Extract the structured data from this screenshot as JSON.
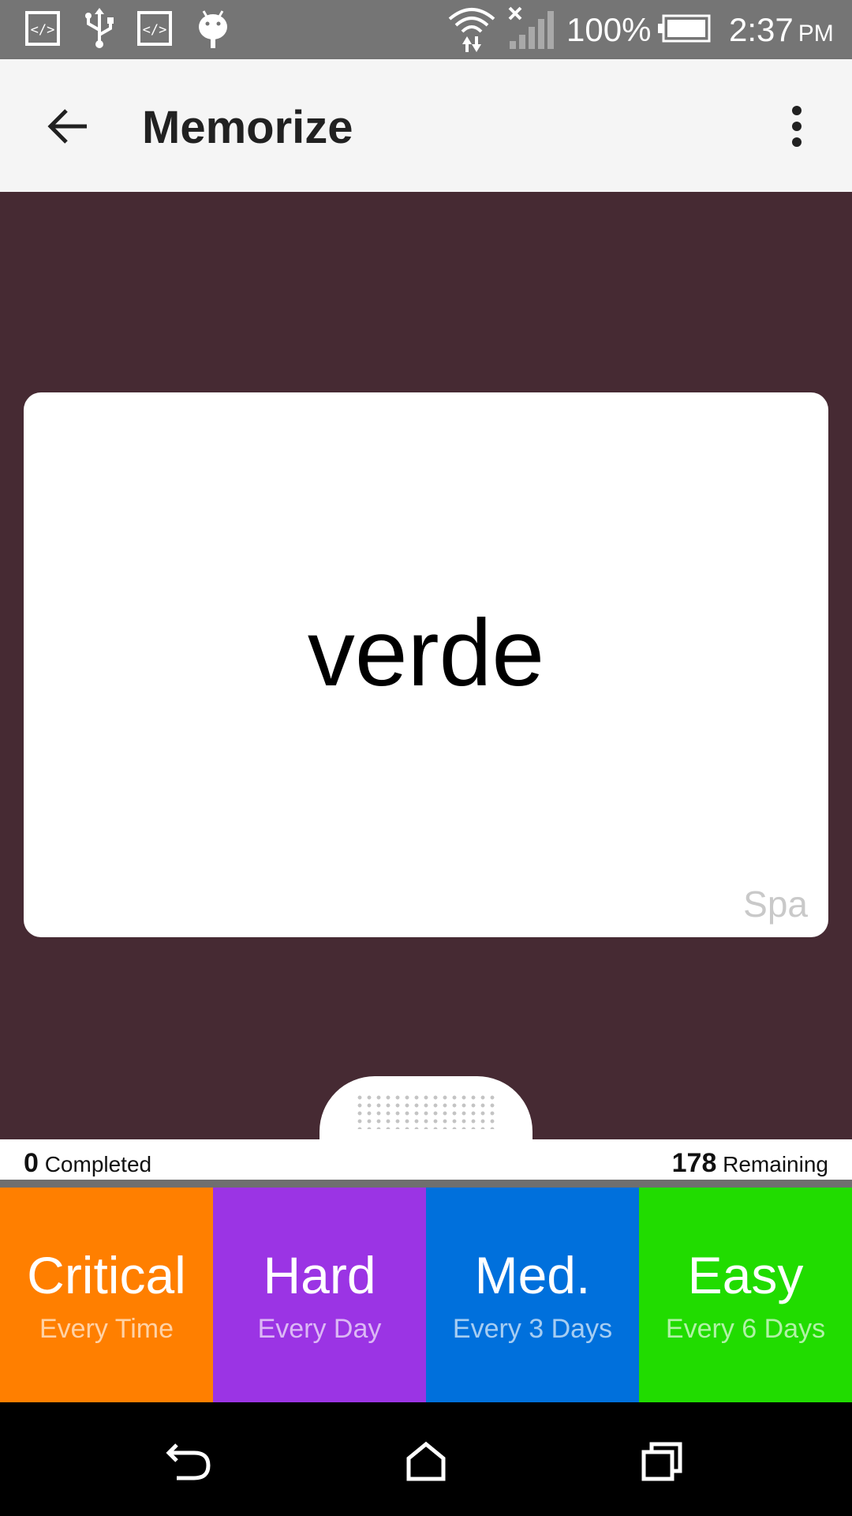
{
  "status_bar": {
    "icons": [
      "code-icon",
      "usb-icon",
      "code-icon",
      "android-icon",
      "wifi-icon",
      "signal-icon",
      "battery-icon"
    ],
    "battery_text": "100%",
    "time": "2:37",
    "ampm": "PM"
  },
  "app_bar": {
    "title": "Memorize",
    "back_icon": "arrow-left-icon",
    "menu_icon": "more-vert-icon"
  },
  "card": {
    "word": "verde",
    "language": "Spa"
  },
  "progress": {
    "completed_count": "0",
    "completed_label": " Completed",
    "remaining_count": "178",
    "remaining_label": " Remaining"
  },
  "rating_buttons": [
    {
      "label": "Critical",
      "sub": "Every Time",
      "color": "#ff7f00"
    },
    {
      "label": "Hard",
      "sub": "Every Day",
      "color": "#9b34e4"
    },
    {
      "label": "Med.",
      "sub": "Every 3 Days",
      "color": "#0070dc"
    },
    {
      "label": "Easy",
      "sub": "Every 6 Days",
      "color": "#21dc00"
    }
  ],
  "colors": {
    "background": "#462a33",
    "status_bar": "#757575",
    "app_bar": "#f5f5f5"
  },
  "nav_icons": [
    "back-icon",
    "home-icon",
    "recents-icon"
  ]
}
